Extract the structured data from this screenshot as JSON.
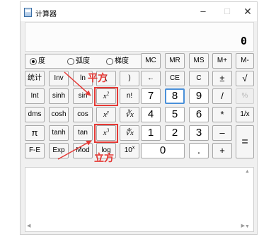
{
  "window": {
    "title": "计算器",
    "minimize": "–",
    "maximize": "□",
    "close": "✕"
  },
  "display": {
    "value": "0"
  },
  "angle_modes": {
    "selected": "度",
    "options": [
      "度",
      "弧度",
      "梯度"
    ]
  },
  "memory_keys": [
    "MC",
    "MR",
    "MS",
    "M+",
    "M-"
  ],
  "rows": {
    "r1": [
      "统计",
      "Inv",
      "ln",
      "(",
      ")",
      "←",
      "CE",
      "C",
      "±",
      "√"
    ],
    "r2": [
      "Int",
      "sinh",
      "sin",
      "x",
      "n!",
      "7",
      "8",
      "9",
      "/",
      "%"
    ],
    "r3": [
      "dms",
      "cosh",
      "cos",
      "x",
      "∛x",
      "4",
      "5",
      "6",
      "*",
      "1/x"
    ],
    "r4": [
      "π",
      "tanh",
      "tan",
      "x",
      "∜x",
      "1",
      "2",
      "3",
      "–",
      "="
    ],
    "r5": [
      "F-E",
      "Exp",
      "Mod",
      "log",
      "10",
      "0",
      ".",
      "+"
    ]
  },
  "superscripts": {
    "square": "2",
    "power": "y",
    "cube": "3",
    "ten_power": "x"
  },
  "annotations": {
    "square": "平方",
    "cube": "立方",
    "color": "#e53935"
  },
  "history": {
    "scroll_up": "▲",
    "scroll_down": "▼",
    "scroll_left": "◀",
    "scroll_right": "▶"
  }
}
